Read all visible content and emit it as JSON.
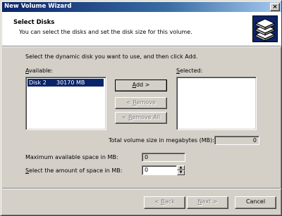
{
  "window": {
    "title": "New Volume Wizard",
    "close_glyph": "×"
  },
  "header": {
    "title": "Select Disks",
    "subtitle": "You can select the disks and set the disk size for this volume.",
    "icon": "disks-icon"
  },
  "instruction": "Select the dynamic disk you want to use, and then click Add.",
  "available": {
    "label_accel": "A",
    "label_rest": "vailable:",
    "items": [
      {
        "disk": "Disk 2",
        "size": "30170 MB",
        "selected": true
      }
    ]
  },
  "selected": {
    "label_pre": "",
    "label_accel": "S",
    "label_rest": "elected:",
    "items": []
  },
  "buttons": {
    "add_accel": "A",
    "add_rest": "dd >",
    "remove_pre": "< ",
    "remove_accel": "R",
    "remove_rest": "emove",
    "remove_all_pre": "< ",
    "remove_all_accel": "R",
    "remove_all_rest": "emove All"
  },
  "total_size": {
    "label": "Total volume size in megabytes (MB):",
    "value": "0"
  },
  "max_space": {
    "label": "Maximum available space in MB:",
    "value": "0"
  },
  "space_amount": {
    "label_accel": "S",
    "label_rest": "elect the amount of space in MB:",
    "value": "0"
  },
  "footer": {
    "back_pre": "< ",
    "back_accel": "B",
    "back_rest": "ack",
    "next_accel": "N",
    "next_rest": "ext >",
    "cancel": "Cancel"
  }
}
